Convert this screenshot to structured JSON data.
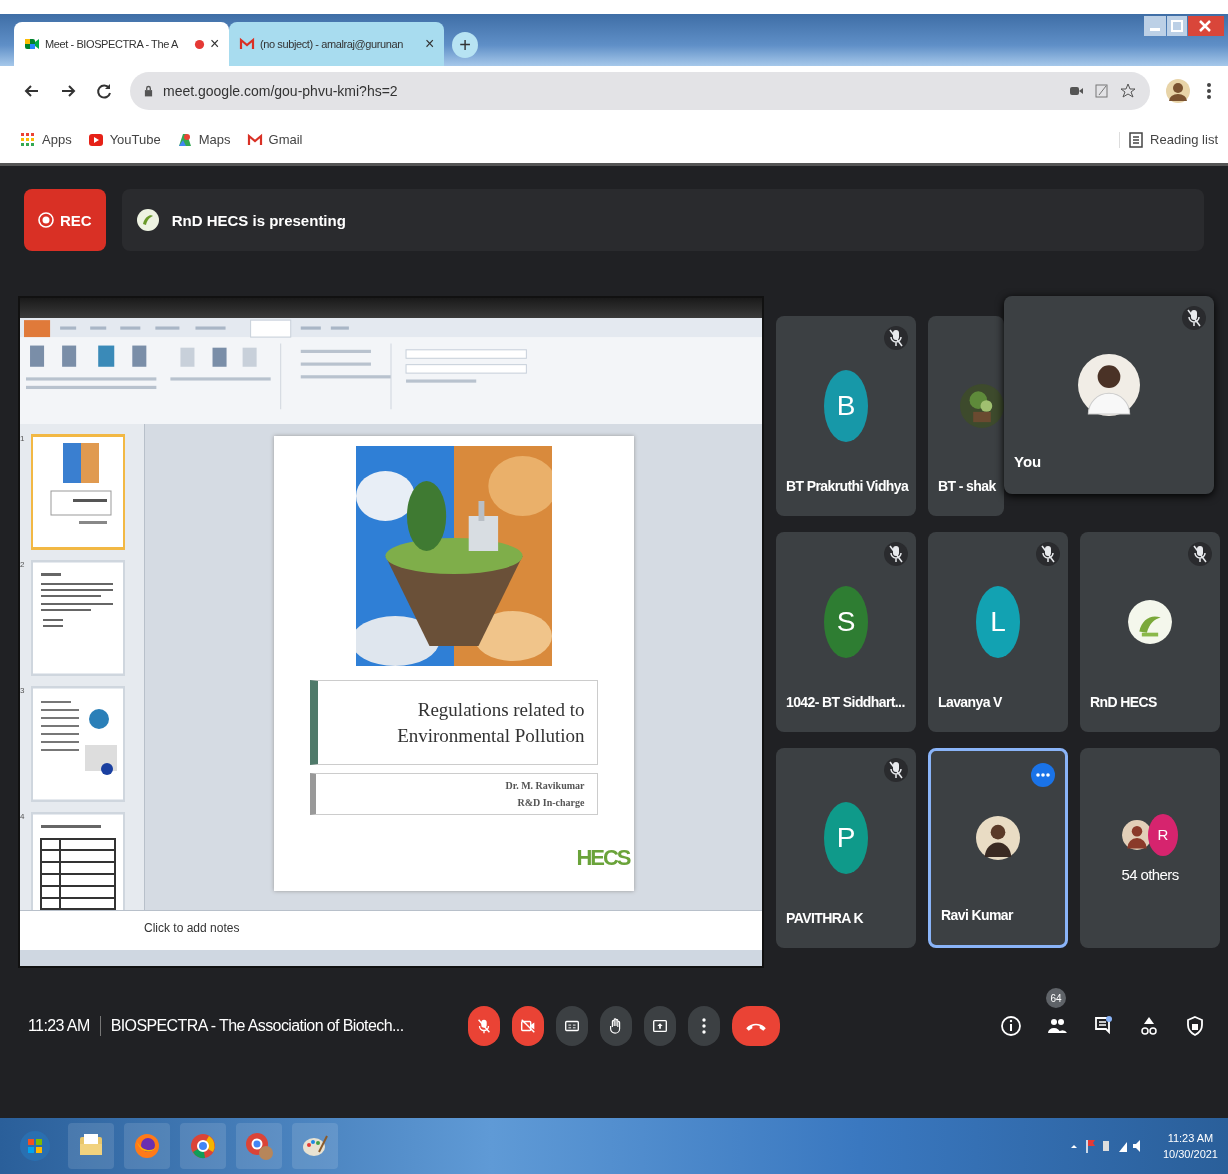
{
  "browser": {
    "tabs": [
      {
        "title": "Meet - BIOSPECTRA - The A",
        "kind": "meet",
        "recording": true,
        "selected": true,
        "close": "×"
      },
      {
        "title": "(no subject) - amalraj@gurunan",
        "kind": "gmail",
        "recording": false,
        "selected": false,
        "close": "×"
      }
    ],
    "new_tab": "+",
    "url": "meet.google.com/gou-phvu-kmi?hs=2",
    "bookmarks": [
      {
        "label": "Apps",
        "kind": "apps"
      },
      {
        "label": "YouTube",
        "kind": "youtube"
      },
      {
        "label": "Maps",
        "kind": "maps"
      },
      {
        "label": "Gmail",
        "kind": "gmail"
      }
    ],
    "reading_list": "Reading list"
  },
  "meet": {
    "recording": {
      "label": "REC"
    },
    "presenting": "RnD HECS is presenting",
    "presentation": {
      "slide_title": "Regulations related to Environmental Pollution",
      "author": "Dr. M. Ravikumar",
      "role": "R&D In-charge",
      "logo": "HECS",
      "notes_placeholder": "Click to add notes",
      "thumbnails": [
        {
          "number": "1",
          "kind": "title",
          "selected": true
        },
        {
          "number": "2",
          "kind": "text",
          "selected": false
        },
        {
          "number": "3",
          "kind": "globe",
          "selected": false
        },
        {
          "number": "4",
          "kind": "table",
          "selected": false
        }
      ]
    },
    "tiles": [
      {
        "kind": "participant",
        "name": "BT Prakruthi Vidhya",
        "avatar": {
          "kind": "letter",
          "letter": "B",
          "color": "#1798a8"
        },
        "muted": true,
        "selected": false
      },
      {
        "kind": "participant",
        "name": "BT - shak",
        "muted": false,
        "selected": false
      },
      {
        "kind": "covered"
      },
      {
        "kind": "participant",
        "name": "1042- BT Siddhart...",
        "avatar": {
          "kind": "letter",
          "letter": "S",
          "color": "#2e7d32"
        },
        "muted": true,
        "selected": false
      },
      {
        "kind": "participant",
        "name": "Lavanya V",
        "avatar": {
          "kind": "letter",
          "letter": "L",
          "color": "#12a2b2"
        },
        "muted": true,
        "selected": false
      },
      {
        "kind": "participant",
        "name": "RnD HECS",
        "avatar": {
          "kind": "logo"
        },
        "muted": true,
        "selected": false
      },
      {
        "kind": "participant",
        "name": "PAVITHRA K",
        "avatar": {
          "kind": "letter",
          "letter": "P",
          "color": "#0f9a8a"
        },
        "muted": true,
        "selected": false
      },
      {
        "kind": "participant",
        "name": "Ravi Kumar",
        "avatar": {
          "kind": "person"
        },
        "muted": false,
        "selected": true
      },
      {
        "kind": "others",
        "label": "54 others",
        "avatars": [
          {
            "kind": "person"
          },
          {
            "kind": "letter",
            "letter": "R",
            "color": "#d6246e"
          }
        ]
      }
    ],
    "self_view": {
      "name": "You",
      "muted": true
    },
    "time": "11:23 AM",
    "meeting_title": "BIOSPECTRA - The Association of Biotech...",
    "controls": [
      {
        "kind": "mic",
        "on": false
      },
      {
        "kind": "camera",
        "on": false
      },
      {
        "kind": "captions",
        "on": false
      },
      {
        "kind": "hand",
        "on": false
      },
      {
        "kind": "present",
        "on": false
      },
      {
        "kind": "more"
      },
      {
        "kind": "leave"
      }
    ],
    "side_controls": [
      {
        "kind": "info"
      },
      {
        "kind": "people",
        "badge": "64"
      },
      {
        "kind": "chat",
        "unread": true
      },
      {
        "kind": "activities"
      },
      {
        "kind": "security"
      }
    ]
  },
  "taskbar": {
    "apps": [
      {
        "kind": "start"
      },
      {
        "kind": "explorer"
      },
      {
        "kind": "firefox"
      },
      {
        "kind": "chrome"
      },
      {
        "kind": "chrome-profile"
      },
      {
        "kind": "paint"
      }
    ],
    "time": "11:23 AM",
    "date": "10/30/2021"
  }
}
